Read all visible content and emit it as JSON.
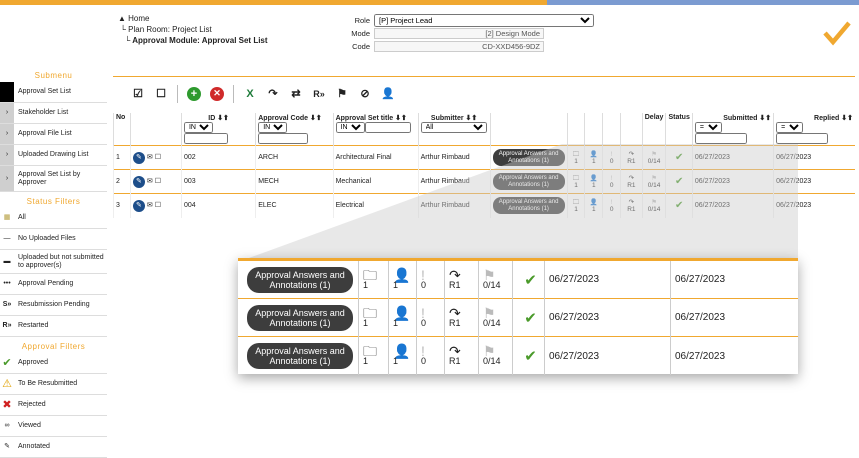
{
  "breadcrumb": {
    "home": "Home",
    "level1": "Plan Room: Project List",
    "level2": "Approval Module: Approval Set List"
  },
  "form": {
    "role_label": "Role",
    "role_value": "[P] Project Lead",
    "mode_label": "Mode",
    "mode_value": "[2] Design Mode",
    "code_label": "Code",
    "code_value": "CD-XXD456-9DZ"
  },
  "sidebar": {
    "submenu_title": "Submenu",
    "submenu": [
      "Approval Set List",
      "Stakeholder List",
      "Approval File List",
      "Uploaded Drawing List",
      "Approval Set List by Approver"
    ],
    "status_title": "Status Filters",
    "status": [
      "All",
      "No Uploaded Files",
      "Uploaded but not submitted to approver(s)",
      "Approval Pending",
      "Resubmission Pending",
      "Restarted"
    ],
    "approval_title": "Approval Filters",
    "approval": [
      "Approved",
      "To Be Resubmitted",
      "Rejected",
      "Viewed",
      "Annotated"
    ]
  },
  "grid": {
    "headers": {
      "no": "No",
      "id": "ID",
      "code": "Approval Code",
      "title": "Approval Set title",
      "submitter": "Submitter",
      "delay": "Delay",
      "status": "Status",
      "submitted": "Submitted",
      "replied": "Replied"
    },
    "filters": {
      "in": "IN",
      "all": "All",
      "eq": "="
    },
    "rows": [
      {
        "no": "1",
        "id": "002",
        "code": "ARCH",
        "title": "Architectural Final",
        "submitter": "Arthur Rimbaud",
        "pill": "Approval Answers and Annotations (1)",
        "f": "1",
        "u": "1",
        "x": "0",
        "r": "R1",
        "d": "0/14",
        "submitted": "06/27/2023",
        "replied": "06/27/2023"
      },
      {
        "no": "2",
        "id": "003",
        "code": "MECH",
        "title": "Mechanical",
        "submitter": "Arthur Rimbaud",
        "pill": "Approval Answers and Annotations (1)",
        "f": "1",
        "u": "1",
        "x": "0",
        "r": "R1",
        "d": "0/14",
        "submitted": "06/27/2023",
        "replied": "06/27/2023"
      },
      {
        "no": "3",
        "id": "004",
        "code": "ELEC",
        "title": "Electrical",
        "submitter": "Arthur Rimbaud",
        "pill": "Approval Answers and Annotations (1)",
        "f": "1",
        "u": "1",
        "x": "0",
        "r": "R1",
        "d": "0/14",
        "submitted": "06/27/2023",
        "replied": "06/27/2023"
      }
    ]
  },
  "colors": {
    "accent": "#f0a830",
    "blue": "#7b9bd1",
    "green": "#4a9a2a"
  }
}
